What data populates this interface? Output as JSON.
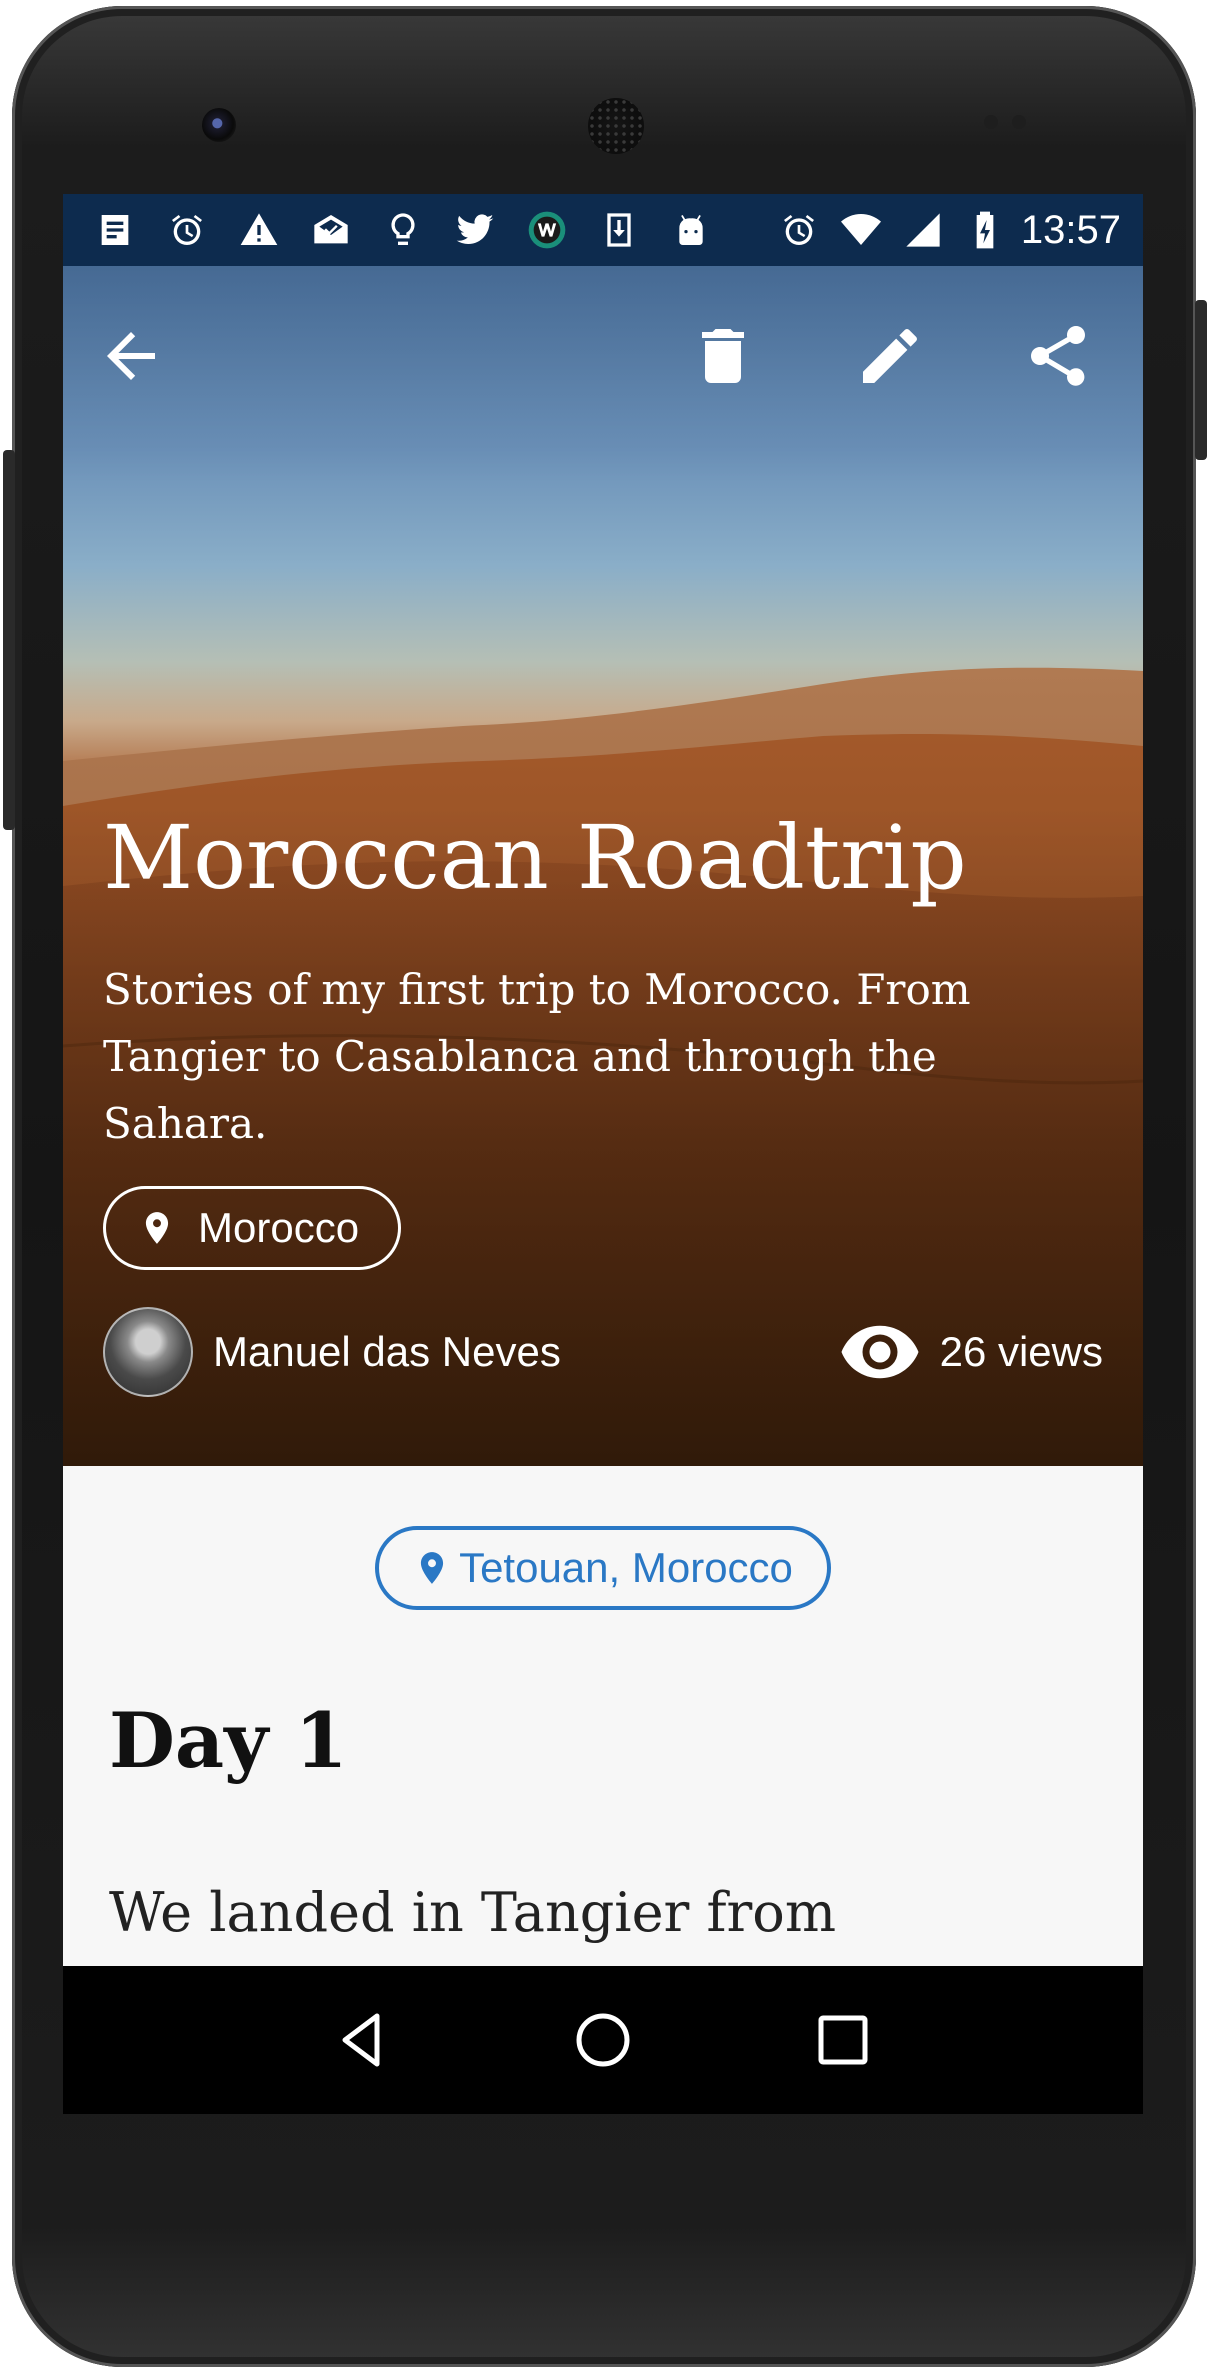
{
  "status_bar": {
    "time": "13:57",
    "left_icons": [
      "notes-icon",
      "alarm-icon",
      "warning-icon",
      "mail-done-icon",
      "lightbulb-icon",
      "twitter-icon",
      "w-app-icon",
      "download-icon",
      "android-icon"
    ],
    "right_icons": [
      "alarm-icon",
      "wifi-icon",
      "signal-icon",
      "battery-charging-icon"
    ],
    "background": "#0d2b4e"
  },
  "toolbar": {
    "back_icon": "arrow-back-icon",
    "actions": [
      "delete-icon",
      "edit-icon",
      "share-icon"
    ]
  },
  "story": {
    "title": "Moroccan Roadtrip",
    "description": "Stories of my first trip to Morocco. From Tangier to Casablanca and through the Sahara.",
    "country": "Morocco",
    "author": "Manuel das Neves",
    "views": "26 views"
  },
  "content": {
    "location": "Tetouan, Morocco",
    "heading": "Day 1",
    "body_preview": "We landed in Tangier from"
  },
  "colors": {
    "accent": "#2a78c5",
    "nav_bar": "#000000"
  },
  "nav": {
    "buttons": [
      "back-triangle-icon",
      "home-circle-icon",
      "recents-square-icon"
    ]
  }
}
